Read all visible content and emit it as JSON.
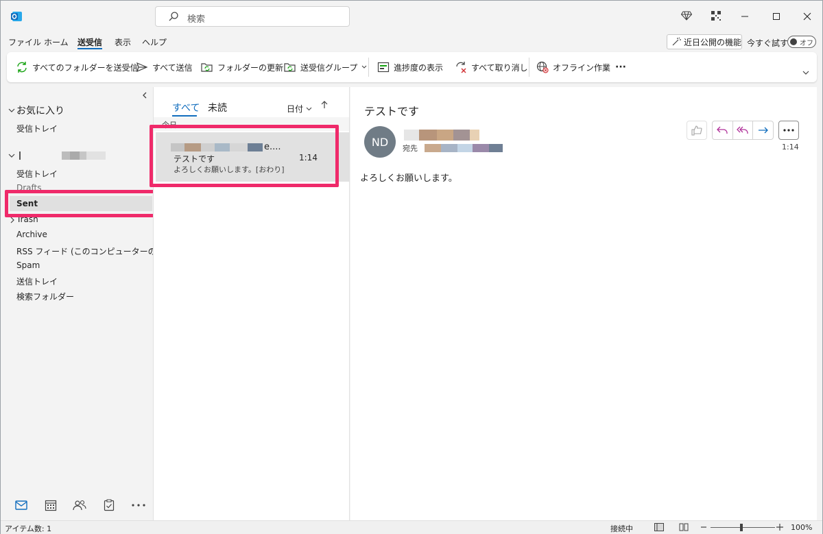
{
  "titlebar": {
    "search_placeholder": "検索"
  },
  "menu": {
    "items": [
      "ファイル",
      "ホーム",
      "送受信",
      "表示",
      "ヘルプ"
    ],
    "active": "送受信",
    "feature_button": "近日公開の機能",
    "try_label": "今すぐ試す",
    "toggle_label": "オフ"
  },
  "ribbon": {
    "send_receive_all": "すべてのフォルダーを送受信",
    "send_all": "すべて送信",
    "update_folder": "フォルダーの更新",
    "send_receive_groups": "送受信グループ",
    "show_progress": "進捗度の表示",
    "cancel_all": "すべて取り消し",
    "work_offline": "オフライン作業",
    "more": "···"
  },
  "folders": {
    "favorites_header": "お気に入り",
    "favorites": [
      "受信トレイ"
    ],
    "account_items": [
      "受信トレイ",
      "Drafts",
      "Sent",
      "Trash",
      "Archive",
      "RSS フィード (このコンピューターのみ)",
      "Spam",
      "送信トレイ",
      "検索フォルダー"
    ],
    "selected": "Sent"
  },
  "list": {
    "tab_all": "すべて",
    "tab_unread": "未読",
    "sort_label": "日付",
    "group_header": "今日",
    "item": {
      "from_suffix": "e....",
      "subject": "テストです",
      "time": "1:14",
      "preview": "よろしくお願いします。[おわり]"
    }
  },
  "reading": {
    "subject": "テストです",
    "avatar_initials": "ND",
    "to_label": "宛先",
    "time": "1:14",
    "body": "よろしくお願いします。"
  },
  "status": {
    "items_count": "アイテム数: 1",
    "connection": "接続中",
    "zoom": "100%"
  },
  "colors": {
    "accent": "#0f6cbd",
    "highlight": "#ef2a6a",
    "avatar": "#707c86",
    "reply": "#b1339b"
  }
}
